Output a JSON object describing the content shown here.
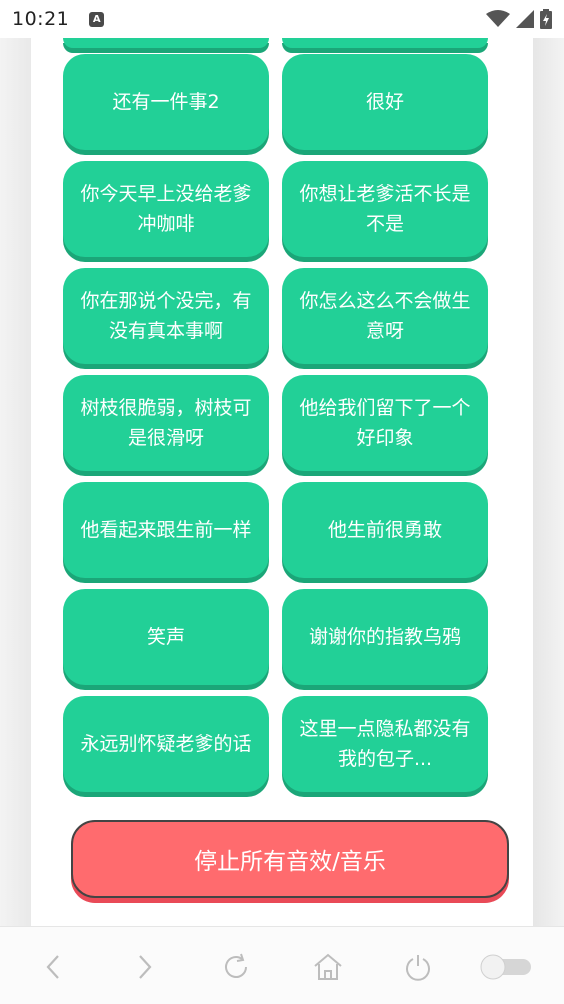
{
  "status_bar": {
    "time": "10:21",
    "notification_letter": "A"
  },
  "sound_buttons": [
    {
      "label": "还有一件事2"
    },
    {
      "label": "很好"
    },
    {
      "label": "你今天早上没给老爹冲咖啡"
    },
    {
      "label": "你想让老爹活不长是不是"
    },
    {
      "label": "你在那说个没完，有没有真本事啊"
    },
    {
      "label": "你怎么这么不会做生意呀"
    },
    {
      "label": "树枝很脆弱，树枝可是很滑呀"
    },
    {
      "label": "他给我们留下了一个好印象"
    },
    {
      "label": "他看起来跟生前一样"
    },
    {
      "label": "他生前很勇敢"
    },
    {
      "label": "笑声"
    },
    {
      "label": "谢谢你的指教乌鸦"
    },
    {
      "label": "永远别怀疑老爹的话"
    },
    {
      "label": "这里一点隐私都没有我的包子..."
    }
  ],
  "stop_button": {
    "label": "停止所有音效/音乐"
  },
  "bottom_nav": {
    "icons": [
      "back-icon",
      "forward-icon",
      "refresh-icon",
      "home-icon",
      "power-icon",
      "toggle-icon"
    ]
  },
  "colors": {
    "button_green": "#22d097",
    "button_shadow": "#1ba678",
    "stop_red": "#ff6b6e"
  }
}
